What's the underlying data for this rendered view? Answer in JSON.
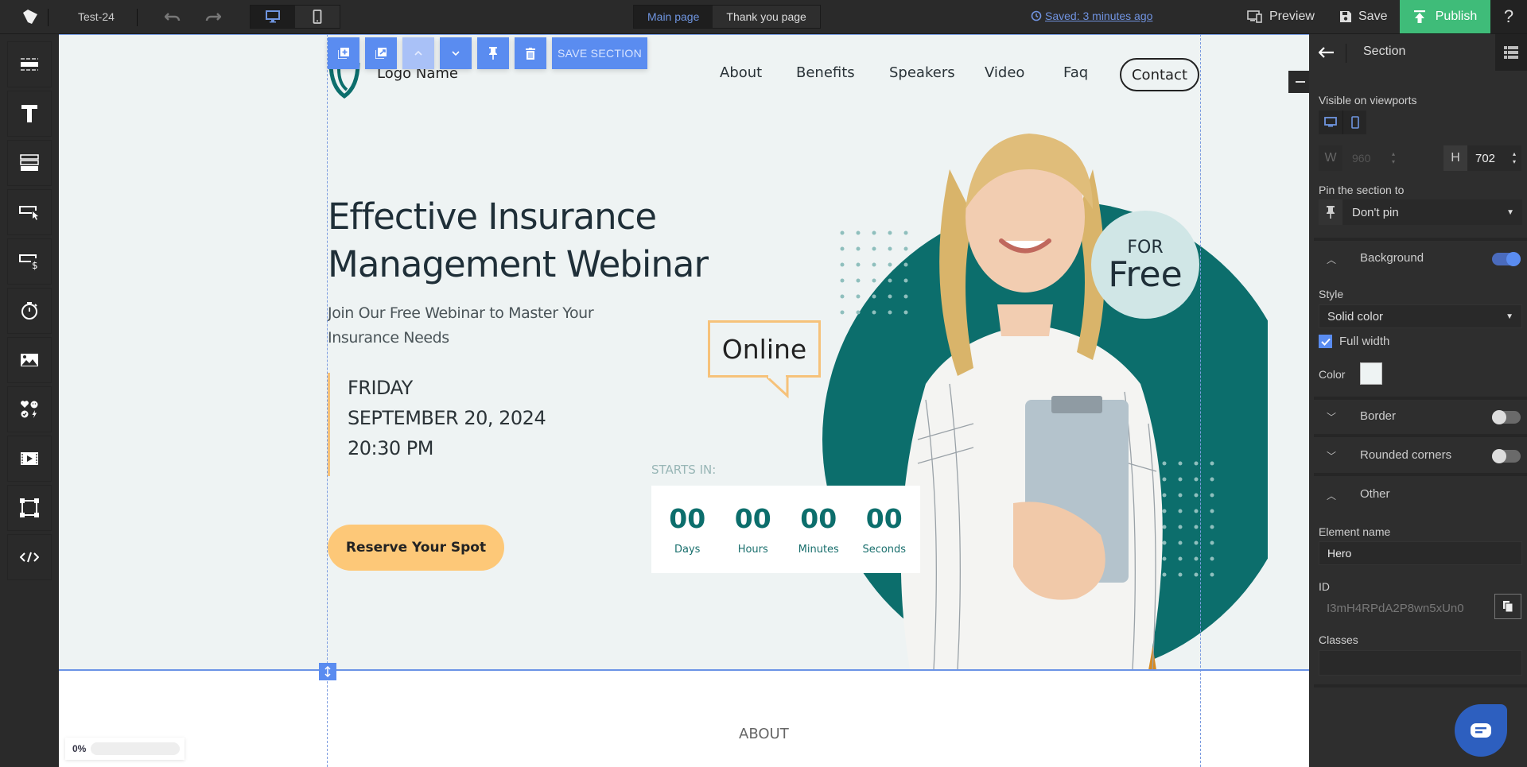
{
  "topbar": {
    "project_name": "Test-24",
    "viewports": [
      {
        "name": "desktop",
        "icon": "monitor-icon",
        "active": true
      },
      {
        "name": "mobile",
        "icon": "phone-icon",
        "active": false
      }
    ],
    "page_tabs": [
      {
        "label": "Main page",
        "active": true
      },
      {
        "label": "Thank you page",
        "active": false
      }
    ],
    "saved_status": "Saved: 3 minutes ago",
    "preview_label": "Preview",
    "save_label": "Save",
    "publish_label": "Publish",
    "help_label": "?"
  },
  "left_toolbar": {
    "tools": [
      {
        "name": "section",
        "icon": "section-icon"
      },
      {
        "name": "text",
        "icon": "text-icon"
      },
      {
        "name": "form",
        "icon": "form-icon"
      },
      {
        "name": "button",
        "icon": "button-cursor-icon"
      },
      {
        "name": "payment-button",
        "icon": "payment-button-icon"
      },
      {
        "name": "timer",
        "icon": "stopwatch-icon"
      },
      {
        "name": "image",
        "icon": "image-icon"
      },
      {
        "name": "icons",
        "icon": "icons-icon"
      },
      {
        "name": "video",
        "icon": "video-icon"
      },
      {
        "name": "shape",
        "icon": "shape-icon"
      },
      {
        "name": "html",
        "icon": "code-icon"
      }
    ]
  },
  "section_toolbar": {
    "buttons": [
      "add-section",
      "duplicate-section",
      "move-up",
      "move-down",
      "pin",
      "delete"
    ],
    "save_section_label": "SAVE SECTION"
  },
  "hero": {
    "logo_name": "Logo Name",
    "nav_links": [
      "About",
      "Benefits",
      "Speakers",
      "Video",
      "Faq"
    ],
    "contact_label": "Contact",
    "title_line1": "Effective Insurance",
    "title_line2": "Management Webinar",
    "subtitle_line1": "Join Our Free Webinar to Master Your",
    "subtitle_line2": "Insurance Needs",
    "date_day": "FRIDAY",
    "date_full": "SEPTEMBER 20, 2024",
    "date_time": "20:30 PM",
    "cta_label": "Reserve Your Spot",
    "online_label": "Online",
    "badge_for": "FOR",
    "badge_free": "Free",
    "starts_in_label": "STARTS IN:",
    "countdown": [
      {
        "value": "00",
        "label": "Days"
      },
      {
        "value": "00",
        "label": "Hours"
      },
      {
        "value": "00",
        "label": "Minutes"
      },
      {
        "value": "00",
        "label": "Seconds"
      }
    ],
    "colors": {
      "accent_teal": "#0c6e6c",
      "accent_orange": "#fdc878",
      "background": "#eef3f3"
    }
  },
  "next_section": {
    "heading": "ABOUT"
  },
  "loading": {
    "percent_label": "0%",
    "progress": 0
  },
  "right_panel": {
    "title": "Section",
    "visible_on_viewports_label": "Visible on viewports",
    "width_label": "W",
    "width_value": "960",
    "height_label": "H",
    "height_value": "702",
    "pin_label": "Pin the section to",
    "pin_value": "Don't pin",
    "background": {
      "label": "Background",
      "enabled": true,
      "style_label": "Style",
      "style_value": "Solid color",
      "full_width_label": "Full width",
      "full_width_checked": true,
      "color_label": "Color",
      "color_value": "#eef3f3"
    },
    "border": {
      "label": "Border",
      "enabled": false
    },
    "rounded_corners": {
      "label": "Rounded corners",
      "enabled": false
    },
    "other": {
      "label": "Other",
      "element_name_label": "Element name",
      "element_name_value": "Hero",
      "id_label": "ID",
      "id_value": "I3mH4RPdA2P8wn5xUn0",
      "classes_label": "Classes",
      "classes_value": ""
    }
  }
}
